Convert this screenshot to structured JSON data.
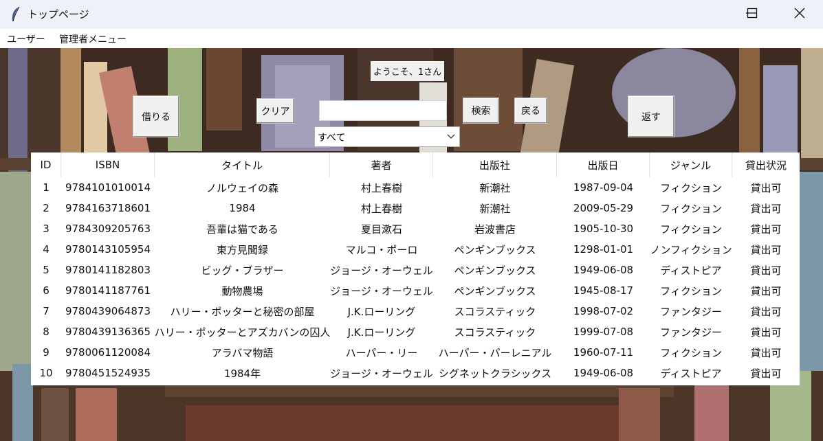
{
  "window": {
    "title": "トップページ"
  },
  "menu": [
    "ユーザー",
    "管理者メニュー"
  ],
  "welcome": "ようこそ、1さん",
  "buttons": {
    "borrow": "借りる",
    "clear": "クリア",
    "search": "検索",
    "back": "戻る",
    "return": "返す"
  },
  "search": {
    "value": ""
  },
  "filter": {
    "selected": "すべて"
  },
  "table": {
    "columns": [
      "ID",
      "ISBN",
      "タイトル",
      "著者",
      "出版社",
      "出版日",
      "ジャンル",
      "貸出状況"
    ],
    "rows": [
      [
        "1",
        "9784101010014",
        "ノルウェイの森",
        "村上春樹",
        "新潮社",
        "1987-09-04",
        "フィクション",
        "貸出可"
      ],
      [
        "2",
        "9784163718601",
        "1984",
        "村上春樹",
        "新潮社",
        "2009-05-29",
        "フィクション",
        "貸出可"
      ],
      [
        "3",
        "9784309205763",
        "吾輩は猫である",
        "夏目漱石",
        "岩波書店",
        "1905-10-30",
        "フィクション",
        "貸出可"
      ],
      [
        "4",
        "9780143105954",
        "東方見聞録",
        "マルコ・ポーロ",
        "ペンギンブックス",
        "1298-01-01",
        "ノンフィクション",
        "貸出可"
      ],
      [
        "5",
        "9780141182803",
        "ビッグ・ブラザー",
        "ジョージ・オーウェル",
        "ペンギンブックス",
        "1949-06-08",
        "ディストピア",
        "貸出可"
      ],
      [
        "6",
        "9780141187761",
        "動物農場",
        "ジョージ・オーウェル",
        "ペンギンブックス",
        "1945-08-17",
        "フィクション",
        "貸出可"
      ],
      [
        "7",
        "9780439064873",
        "ハリー・ポッターと秘密の部屋",
        "J.K.ローリング",
        "スコラスティック",
        "1998-07-02",
        "ファンタジー",
        "貸出可"
      ],
      [
        "8",
        "9780439136365",
        "ハリー・ポッターとアズカバンの囚人",
        "J.K.ローリング",
        "スコラスティック",
        "1999-07-08",
        "ファンタジー",
        "貸出可"
      ],
      [
        "9",
        "9780061120084",
        "アラバマ物語",
        "ハーパー・リー",
        "ハーパー・パーレニアル",
        "1960-07-11",
        "フィクション",
        "貸出可"
      ],
      [
        "10",
        "9780451524935",
        "1984年",
        "ジョージ・オーウェル",
        "シグネットクラシックス",
        "1949-06-08",
        "ディストピア",
        "貸出可"
      ]
    ]
  }
}
